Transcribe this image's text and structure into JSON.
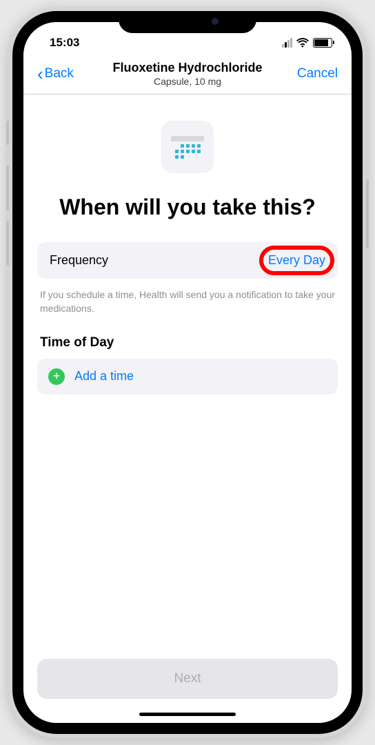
{
  "statusBar": {
    "time": "15:03"
  },
  "nav": {
    "back_label": "Back",
    "title": "Fluoxetine Hydrochloride",
    "subtitle": "Capsule, 10 mg",
    "cancel_label": "Cancel"
  },
  "heading": "When will you take this?",
  "frequency": {
    "label": "Frequency",
    "value": "Every Day"
  },
  "helper_text": "If you schedule a time, Health will send you a notification to take your medications.",
  "time_section": {
    "header": "Time of Day",
    "add_label": "Add a time"
  },
  "next_button_label": "Next"
}
